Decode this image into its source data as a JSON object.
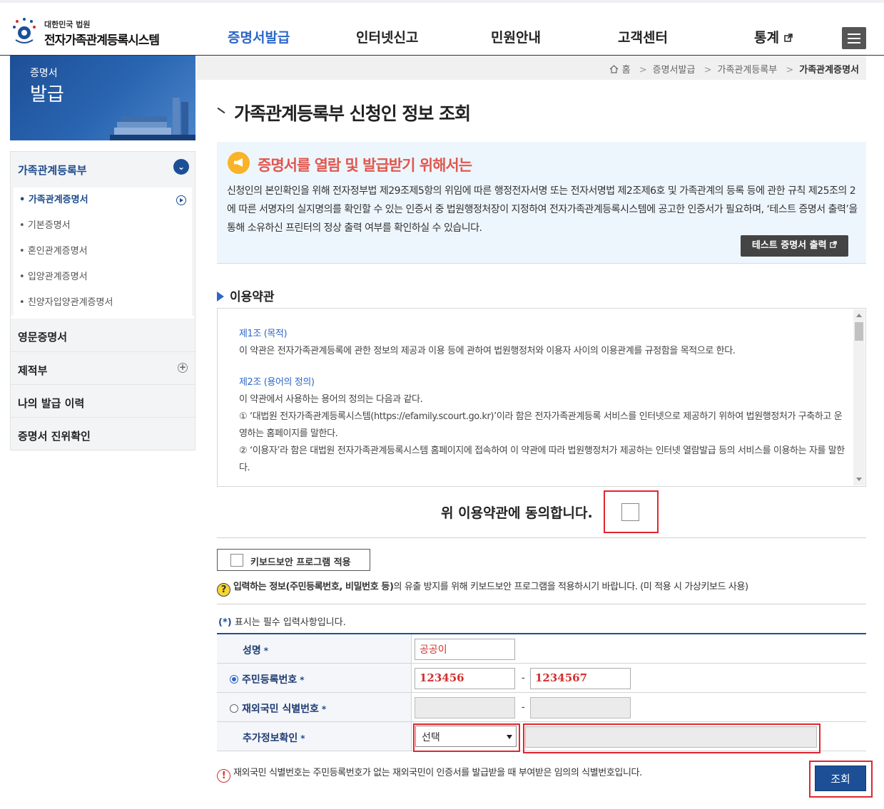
{
  "header": {
    "logo_line1": "대한민국 법원",
    "logo_line2": "전자가족관계등록시스템",
    "nav": [
      "증명서발급",
      "인터넷신고",
      "민원안내",
      "고객센터",
      "통계"
    ],
    "active_color": "#2c67c9"
  },
  "banner": {
    "small": "증명서",
    "big": "발급"
  },
  "sidebar": {
    "group": "가족관계등록부",
    "subitems": [
      "가족관계증명서",
      "기본증명서",
      "혼인관계증명서",
      "입양관계증명서",
      "친양자입양관계증명서"
    ],
    "items": [
      "영문증명서",
      "제적부",
      "나의 발급 이력",
      "증명서 진위확인"
    ]
  },
  "breadcrumb": [
    "홈",
    "증명서발급",
    "가족관계등록부",
    "가족관계증명서"
  ],
  "page_title": "가족관계등록부 신청인 정보 조회",
  "notice": {
    "heading": "증명서를 열람 및 발급받기 위해서는",
    "body": "신청인의 본인확인을 위해 전자정부법 제29조제5항의 위임에 따른 행정전자서명 또는 전자서명법 제2조제6호 및 가족관계의 등록 등에 관한 규칙 제25조의 2에 따른 서명자의 실지명의를 확인할 수 있는 인증서 중 법원행정처장이 지정하여 전자가족관계등록시스템에 공고한 인증서가 필요하며, ‘테스트 증명서 출력’을 통해 소유하신 프린터의 정상 출력 여부를 확인하실 수 있습니다.",
    "button": "테스트 증명서 출력"
  },
  "terms": {
    "title": "이용약관",
    "art1_title": "제1조 (목적)",
    "art1_body": "이 약관은 전자가족관계등록에 관한 정보의 제공과 이용 등에 관하여 법원행정처와 이용자 사이의 이용관계를 규정함을 목적으로 한다.",
    "art2_title": "제2조 (용어의 정의)",
    "art2_l1": "이 약관에서 사용하는 용어의 정의는 다음과 같다.",
    "art2_l2": "① ‘대법원 전자가족관계등록시스템(https://efamily.scourt.go.kr)’이라 함은 전자가족관계등록 서비스를 인터넷으로 제공하기 위하여 법원행정처가 구축하고 운영하는 홈페이지를 말한다.",
    "art2_l3": "② ‘이용자’라 함은 대법원 전자가족관계등록시스템 홈페이지에 접속하여 이 약관에 따라 법원행정처가 제공하는 인터넷 열람발급 등의 서비스를 이용하는 자를 말한다.",
    "agree": "위 이용약관에 동의합니다."
  },
  "keyboard": {
    "label": "키보드보안 프로그램 적용",
    "hint_bold": "입력하는 정보(주민등록번호, 비밀번호 등)",
    "hint_rest": "의 유출 방지를 위해 키보드보안 프로그램을 적용하시기 바랍니다. (미 적용 시 가상키보드 사용)"
  },
  "form": {
    "required_mark": "(*)",
    "required_note": " 표시는 필수 입력사항입니다.",
    "name_label": "성명",
    "name_value": "공공이",
    "rrn_label": "주민등록번호",
    "rrn_front": "123456",
    "rrn_back": "1234567",
    "overseas_label": "재외국민 식별번호",
    "extra_label": "추가정보확인",
    "extra_select": "선택",
    "star": "*",
    "dash": "-"
  },
  "footer_note": "재외국민 식별번호는 주민등록번호가 없는 재외국민이 인증서를 발급받을 때 부여받은 임의의 식별번호입니다.",
  "submit": "조회"
}
